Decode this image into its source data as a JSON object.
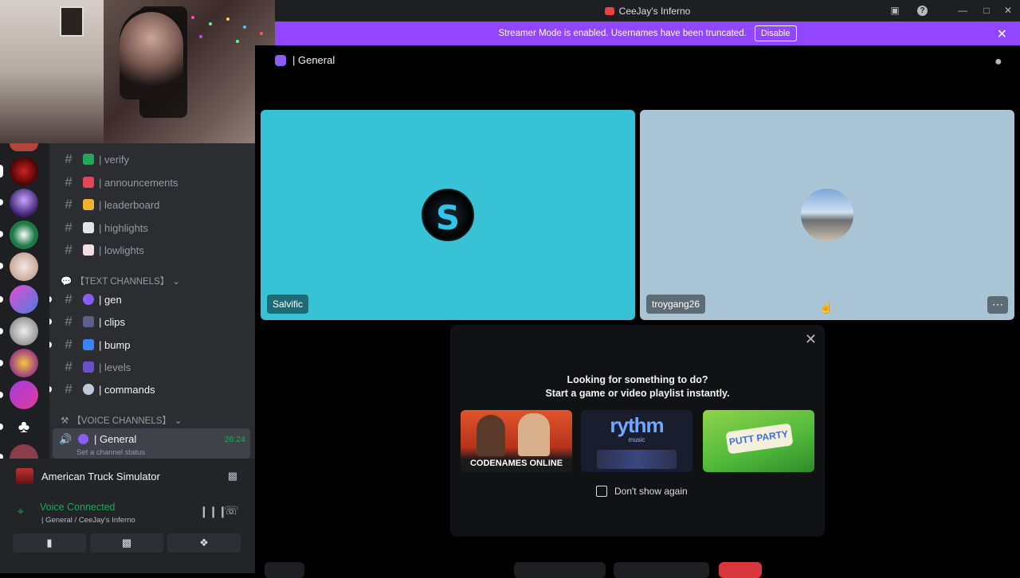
{
  "window": {
    "title": "CeeJay's Inferno"
  },
  "banner": {
    "text": "Streamer Mode is enabled. Usernames have been truncated.",
    "disable_label": "Disable"
  },
  "voice_header": {
    "channel": "| General"
  },
  "channels": {
    "items": [
      {
        "label": "| verify"
      },
      {
        "label": "| announcements"
      },
      {
        "label": "| leaderboard"
      },
      {
        "label": "| highlights"
      },
      {
        "label": "| lowlights"
      }
    ],
    "text_category": "【TEXT CHANNELS】",
    "text_items": [
      {
        "label": "| gen"
      },
      {
        "label": "| clips"
      },
      {
        "label": "| bump"
      },
      {
        "label": "| levels"
      },
      {
        "label": "| commands"
      }
    ],
    "voice_category": "【VOICE CHANNELS】",
    "voice_channel": {
      "label": "| General",
      "time": "26:24",
      "status": "Set a channel status"
    }
  },
  "panel": {
    "game": "American Truck Simulator",
    "voice_title": "Voice Connected",
    "voice_sub": "| General / CeeJay's Inferno"
  },
  "tiles": [
    {
      "name": "Salvific",
      "bg": "#37c2d6"
    },
    {
      "name": "troygang26",
      "bg": "#a9c4d4"
    }
  ],
  "activity": {
    "line1": "Looking for something to do?",
    "line2": "Start a game or video playlist instantly.",
    "cards": [
      {
        "name": "CODENAMES ONLINE"
      },
      {
        "name": "rythm",
        "sub": "music"
      },
      {
        "name": "PUTT PARTY"
      }
    ],
    "dont_show": "Don't show again"
  },
  "colors": {
    "accent": "#9146ff",
    "voice_green": "#23a55a"
  }
}
